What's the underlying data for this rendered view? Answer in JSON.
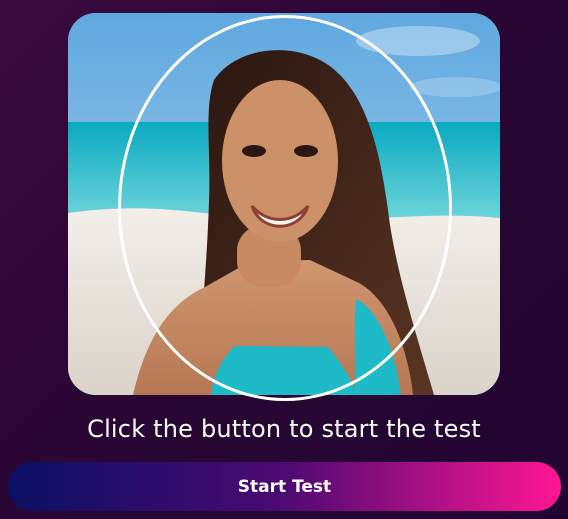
{
  "photo": {
    "subject": "portrait-photo",
    "accent_color": "#1fbac8"
  },
  "capture": {
    "instruction_text": "Click the button to start the test"
  },
  "actions": {
    "start_label": "Start Test"
  },
  "theme": {
    "background_start": "#3a0a3f",
    "background_end": "#210531",
    "button_start": "#0a0f63",
    "button_end": "#ff1693",
    "guide_color": "#ffffff",
    "text_color": "#ffffff"
  }
}
